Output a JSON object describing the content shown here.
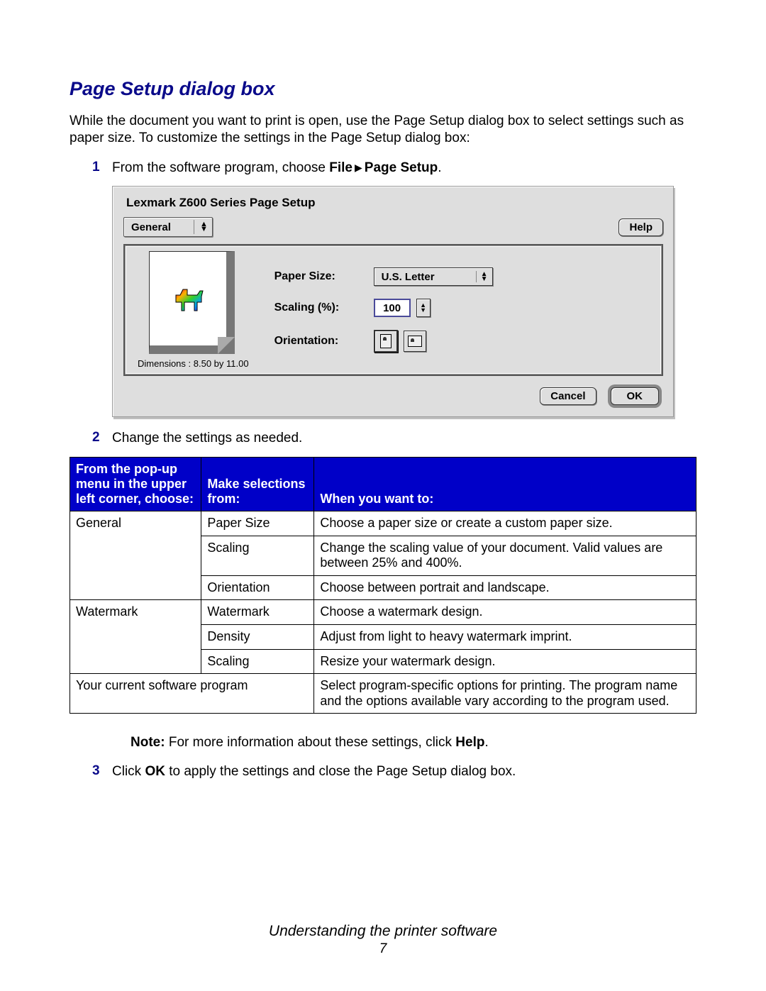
{
  "section_title": "Page Setup dialog box",
  "intro_text": "While the document you want to print is open, use the Page Setup dialog box to select settings such as paper size. To customize the settings in the Page Setup dialog box:",
  "steps": {
    "s1": {
      "num": "1",
      "prefix": "From the software program, choose ",
      "bold_a": "File",
      "bold_b": "Page Setup",
      "suffix": "."
    },
    "s2": {
      "num": "2",
      "text": "Change the settings as needed."
    },
    "s3": {
      "num": "3",
      "prefix": "Click ",
      "bold_a": "OK",
      "suffix": " to apply the settings and close the Page Setup dialog box."
    }
  },
  "dialog": {
    "title": "Lexmark Z600 Series Page Setup",
    "menu_label": "General",
    "help": "Help",
    "dimensions": "Dimensions : 8.50 by 11.00",
    "labels": {
      "paper": "Paper Size:",
      "scaling": "Scaling (%):",
      "orient": "Orientation:"
    },
    "values": {
      "paper": "U.S. Letter",
      "scaling": "100"
    },
    "buttons": {
      "cancel": "Cancel",
      "ok": "OK"
    }
  },
  "table": {
    "h1": "From the pop-up menu in the upper left corner, choose:",
    "h2": "Make selections from:",
    "h3": "When you want to:",
    "rows": {
      "g": "General",
      "g_paper": "Paper Size",
      "g_paper_d": "Choose a paper size or create a custom paper size.",
      "g_scale": "Scaling",
      "g_scale_d": "Change the scaling value of your document. Valid values are between 25% and 400%.",
      "g_orient": "Orientation",
      "g_orient_d": "Choose between portrait and landscape.",
      "w": "Watermark",
      "w_wm": "Watermark",
      "w_wm_d": "Choose a watermark design.",
      "w_den": "Density",
      "w_den_d": "Adjust from light to heavy watermark imprint.",
      "w_scale": "Scaling",
      "w_scale_d": "Resize your watermark design.",
      "sp": "Your current software program",
      "sp_d": "Select program-specific options for printing. The program name and the options available vary according to the program used."
    }
  },
  "note": {
    "label": "Note:",
    "text": " For more information about these settings, click ",
    "bold": "Help",
    "suffix": "."
  },
  "footer": {
    "chapter": "Understanding the printer software",
    "page": "7"
  }
}
